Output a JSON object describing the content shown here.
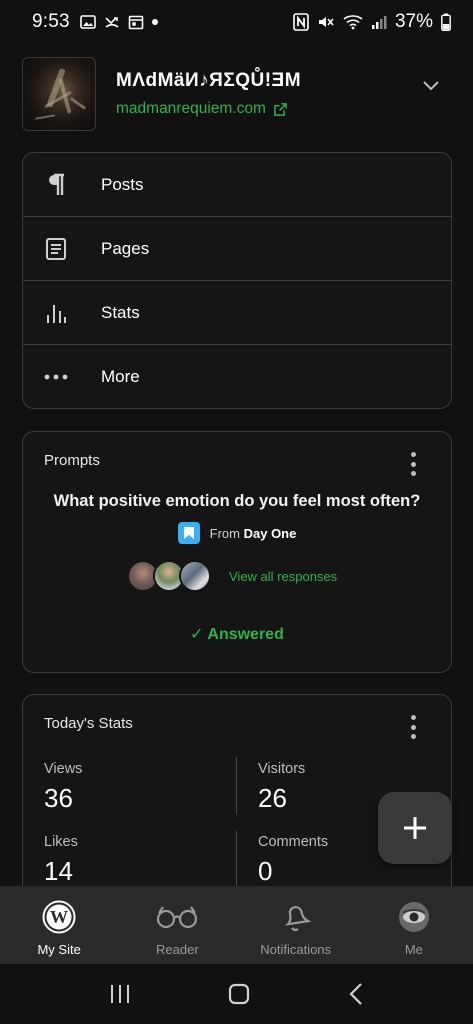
{
  "status_bar": {
    "time": "9:53",
    "battery": "37%"
  },
  "site": {
    "title": "MΛdMäИ♪ЯΣQŮ!ƎM",
    "url": "madmanrequiem.com"
  },
  "menu": {
    "items": [
      {
        "label": "Posts",
        "icon": "pilcrow-icon"
      },
      {
        "label": "Pages",
        "icon": "page-icon"
      },
      {
        "label": "Stats",
        "icon": "stats-bars-icon"
      },
      {
        "label": "More",
        "icon": "ellipsis-icon"
      }
    ]
  },
  "prompts": {
    "title": "Prompts",
    "question": "What positive emotion do you feel most often?",
    "from_prefix": "From",
    "from_source": "Day One",
    "view_all": "View all responses",
    "answered": "✓ Answered"
  },
  "stats": {
    "title": "Today's Stats",
    "views_label": "Views",
    "views_value": "36",
    "visitors_label": "Visitors",
    "visitors_value": "26",
    "likes_label": "Likes",
    "likes_value": "14",
    "comments_label": "Comments",
    "comments_value": "0"
  },
  "tabs": [
    {
      "label": "My Site",
      "icon": "wordpress-icon",
      "active": true
    },
    {
      "label": "Reader",
      "icon": "glasses-icon",
      "active": false
    },
    {
      "label": "Notifications",
      "icon": "bell-icon",
      "active": false
    },
    {
      "label": "Me",
      "icon": "avatar-icon",
      "active": false
    }
  ],
  "colors": {
    "accent_green": "#2eb34a",
    "background": "#111111",
    "card_border": "#3c3c3c"
  }
}
